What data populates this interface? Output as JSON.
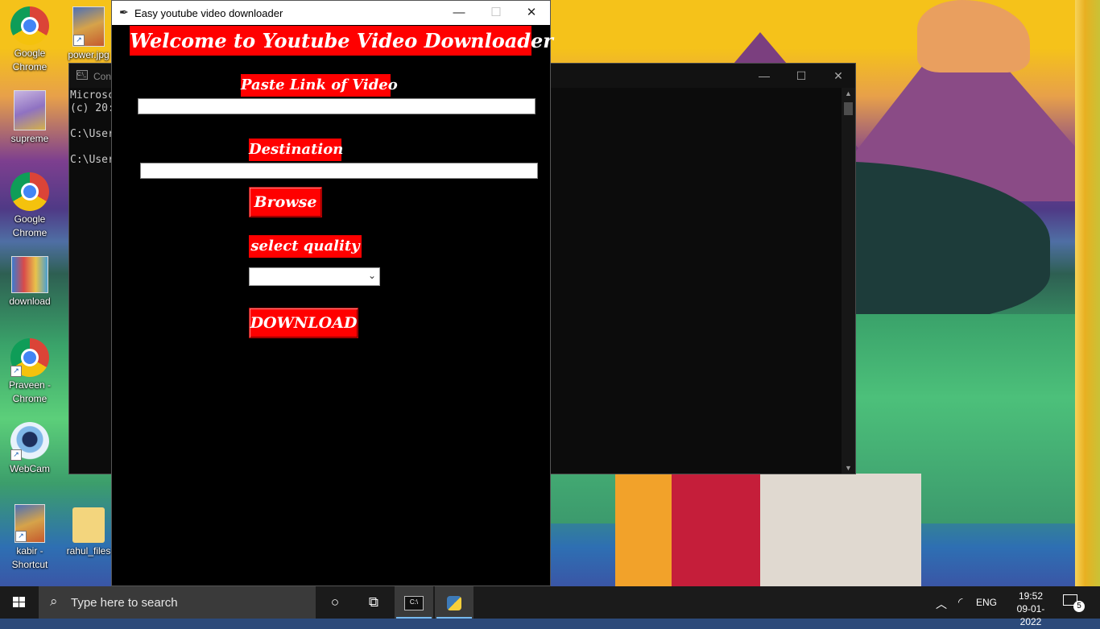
{
  "desktop": {
    "icons": [
      {
        "label": "Google Chrome",
        "icon": "chrome-icon"
      },
      {
        "label": "power.jpg",
        "icon": "image-file-icon"
      },
      {
        "label": "supreme",
        "icon": "image-file-icon"
      },
      {
        "label": "Google Chrome",
        "icon": "chrome-icon"
      },
      {
        "label": "download",
        "icon": "image-file-icon"
      },
      {
        "label": "Praveen - Chrome",
        "icon": "chrome-icon"
      },
      {
        "label": "WebCam",
        "icon": "webcam-icon"
      },
      {
        "label": "kabir - Shortcut",
        "icon": "image-file-icon"
      },
      {
        "label": "rahul_files",
        "icon": "folder-icon"
      }
    ]
  },
  "console": {
    "title": "Con",
    "lines": [
      "Microsc",
      "(c) 20:",
      "",
      "C:\\User",
      "",
      "C:\\User"
    ],
    "minimize": "—",
    "maximize": "☐",
    "close": "✕"
  },
  "app": {
    "title": "Easy youtube video downloader",
    "heading": "Welcome to Youtube Video Downloader",
    "link_label": "Paste Link of Video",
    "link_value": "",
    "destination_label": "Destination",
    "destination_value": "",
    "browse_button": "Browse",
    "quality_label": "select quality",
    "quality_selected": "",
    "download_button": "DOWNLOAD",
    "minimize": "—",
    "maximize": "☐",
    "close": "✕",
    "colors": {
      "accent": "#ff0000",
      "background": "#000000",
      "text": "#ffffff"
    }
  },
  "taskbar": {
    "search_placeholder": "Type here to search",
    "language": "ENG",
    "time": "19:52",
    "date": "09-01-2022",
    "notification_count": "5"
  }
}
